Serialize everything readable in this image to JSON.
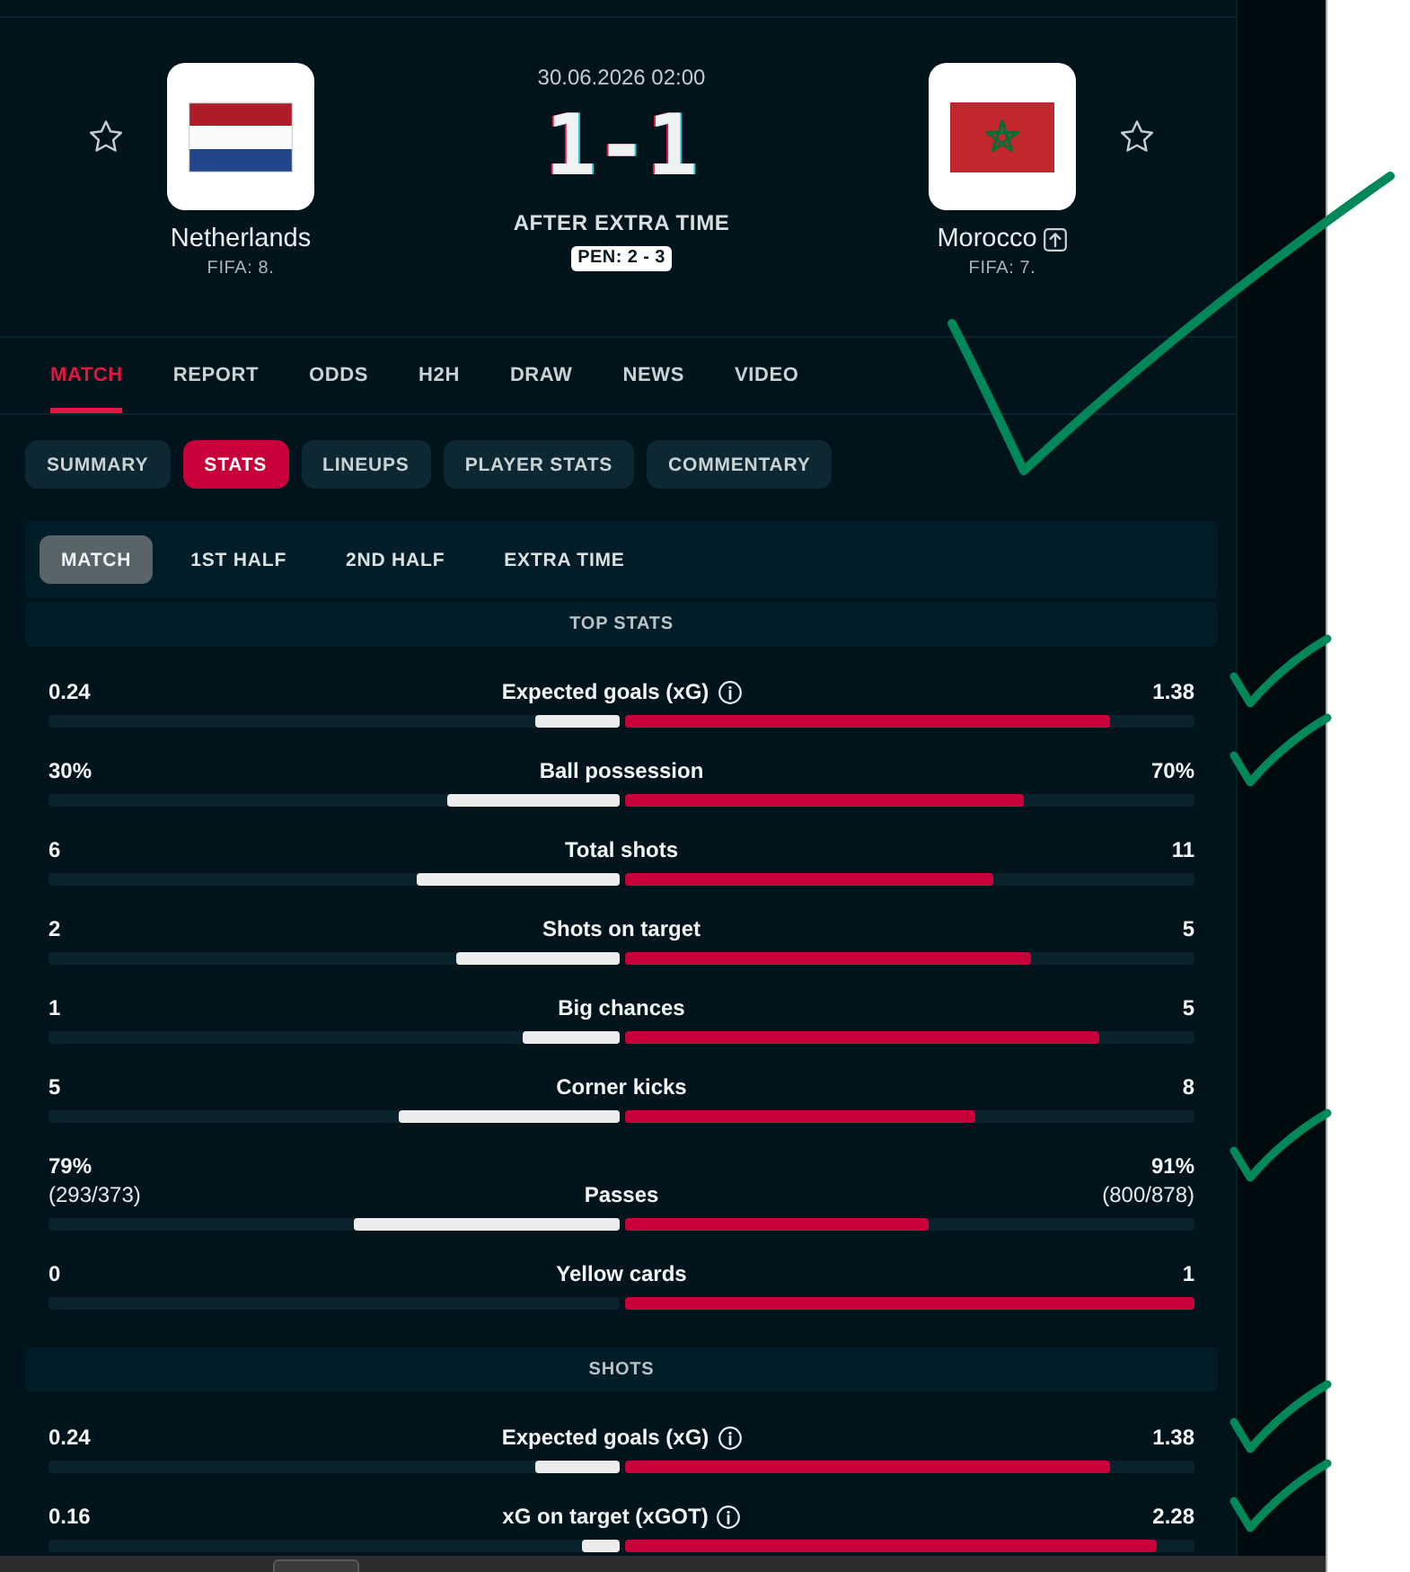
{
  "header": {
    "date": "30.06.2026 02:00",
    "score": "1-1",
    "status": "AFTER EXTRA TIME",
    "penalties": "PEN: 2 - 3",
    "teams": [
      {
        "name": "Netherlands",
        "rank": "FIFA: 8.",
        "favorite": false,
        "rank_up": false
      },
      {
        "name": "Morocco",
        "rank": "FIFA: 7.",
        "favorite": false,
        "rank_up": true
      }
    ]
  },
  "tabs": [
    {
      "label": "MATCH",
      "selected": true
    },
    {
      "label": "REPORT",
      "selected": false
    },
    {
      "label": "ODDS",
      "selected": false
    },
    {
      "label": "H2H",
      "selected": false
    },
    {
      "label": "DRAW",
      "selected": false
    },
    {
      "label": "NEWS",
      "selected": false
    },
    {
      "label": "VIDEO",
      "selected": false
    }
  ],
  "sub_tabs": {
    "check_mark": true,
    "items": [
      {
        "label": "SUMMARY",
        "selected": false
      },
      {
        "label": "STATS",
        "selected": true
      },
      {
        "label": "LINEUPS",
        "selected": false
      },
      {
        "label": "PLAYER STATS",
        "selected": false
      },
      {
        "label": "COMMENTARY",
        "selected": false
      }
    ]
  },
  "periods": [
    {
      "label": "MATCH",
      "selected": true
    },
    {
      "label": "1ST HALF",
      "selected": false
    },
    {
      "label": "2ND HALF",
      "selected": false
    },
    {
      "label": "EXTRA TIME",
      "selected": false
    }
  ],
  "sections": [
    {
      "title": "TOP STATS",
      "rows": [
        {
          "label": "Expected goals (xG)",
          "info": true,
          "check_mark": true,
          "home": {
            "value": "0.24",
            "level": 0.148
          },
          "away": {
            "value": "1.38",
            "level": 0.852
          }
        },
        {
          "label": "Ball possession",
          "info": false,
          "check_mark": true,
          "home": {
            "value": "30%",
            "level": 0.3
          },
          "away": {
            "value": "70%",
            "level": 0.7
          }
        },
        {
          "label": "Total shots",
          "info": false,
          "check_mark": false,
          "home": {
            "value": "6",
            "level": 0.353
          },
          "away": {
            "value": "11",
            "level": 0.647
          }
        },
        {
          "label": "Shots on target",
          "info": false,
          "check_mark": false,
          "home": {
            "value": "2",
            "level": 0.286
          },
          "away": {
            "value": "5",
            "level": 0.714
          }
        },
        {
          "label": "Big chances",
          "info": false,
          "check_mark": false,
          "home": {
            "value": "1",
            "level": 0.167
          },
          "away": {
            "value": "5",
            "level": 0.833
          }
        },
        {
          "label": "Corner kicks",
          "info": false,
          "check_mark": false,
          "home": {
            "value": "5",
            "level": 0.385
          },
          "away": {
            "value": "8",
            "level": 0.615
          }
        },
        {
          "label": "Passes",
          "info": false,
          "check_mark": true,
          "home": {
            "value": "79%",
            "detail": "(293/373)",
            "level": 0.465
          },
          "away": {
            "value": "91%",
            "detail": "(800/878)",
            "level": 0.535
          }
        },
        {
          "label": "Yellow cards",
          "info": false,
          "check_mark": false,
          "home": {
            "value": "0",
            "level": 0
          },
          "away": {
            "value": "1",
            "level": 1
          }
        }
      ]
    },
    {
      "title": "SHOTS",
      "rows": [
        {
          "label": "Expected goals (xG)",
          "info": true,
          "check_mark": true,
          "home": {
            "value": "0.24",
            "level": 0.148
          },
          "away": {
            "value": "1.38",
            "level": 0.852
          }
        },
        {
          "label": "xG on target (xGOT)",
          "info": true,
          "check_mark": true,
          "home": {
            "value": "0.16",
            "level": 0.066
          },
          "away": {
            "value": "2.28",
            "level": 0.934
          }
        }
      ]
    }
  ]
}
